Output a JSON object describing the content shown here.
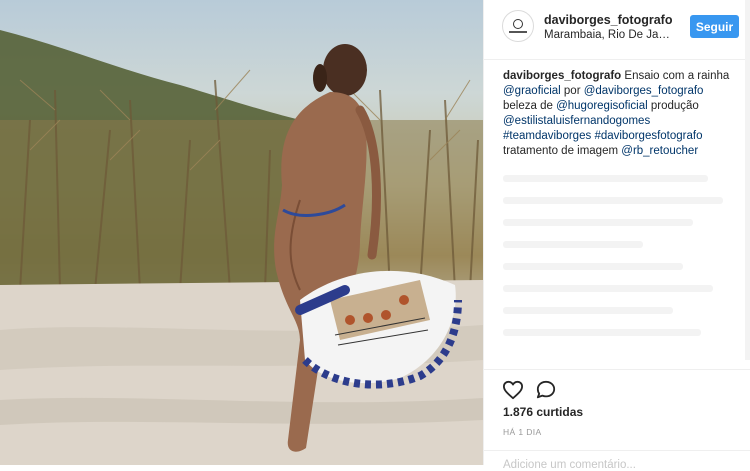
{
  "post": {
    "image_alt": "Beach photo with feathered headdress"
  },
  "header": {
    "username": "daviborges_fotografo",
    "location": "Marambaia, Rio De Janeiro",
    "follow_label": "Seguir"
  },
  "caption": {
    "username": "daviborges_fotografo",
    "text1": " Ensaio com a rainha ",
    "mention1": "@graoficial",
    "text2": " por ",
    "mention2": "@daviborges_fotografo",
    "text3": " beleza de ",
    "mention3": "@hugoregisoficial",
    "text4": " produção ",
    "mention4": "@estilistaluisfernandogomes",
    "text5": " ",
    "hashtag1": "#teamdaviborges",
    "text6": " ",
    "hashtag2": "#daviborgesfotografo",
    "text7": " tratamento de imagem ",
    "mention5": "@rb_retoucher"
  },
  "actions": {
    "like_icon": "heart-icon",
    "comment_icon": "comment-icon"
  },
  "stats": {
    "likes": "1.876 curtidas",
    "time": "HÁ 1 DIA"
  },
  "comment": {
    "placeholder": "Adicione um comentário..."
  },
  "colors": {
    "follow_button": "#3897f0",
    "link": "#003569",
    "border": "#efefef"
  }
}
